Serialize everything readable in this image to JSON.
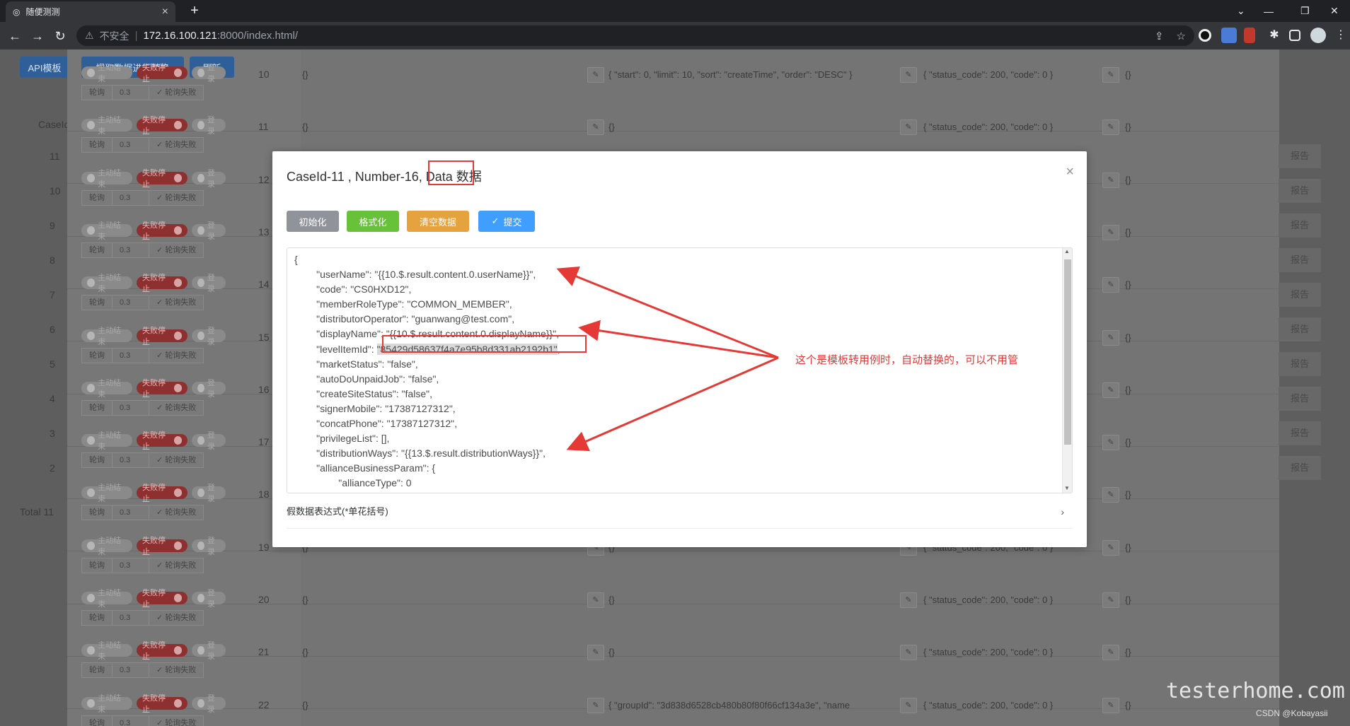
{
  "browser": {
    "tab_title": "随便测测",
    "insecure_label": "不安全",
    "url_host": "172.16.100.121",
    "url_path": ":8000/index.html/"
  },
  "toolbar": {
    "api_label": "API模板",
    "extract_label": "提取数据进行替换",
    "refresh_label": "刷新"
  },
  "left": {
    "caseid_header": "CaseId",
    "ids": [
      "11",
      "10",
      "9",
      "8",
      "7",
      "6",
      "5",
      "4",
      "3",
      "2"
    ],
    "total_label": "Total 11"
  },
  "row_controls": {
    "active_label": "主动结束",
    "fail_stop_label": "失败停止",
    "login_label": "登录",
    "poll_label": "轮询",
    "poll_value": "0.3",
    "poll_fail_label": "轮询失败"
  },
  "rows": [
    {
      "num": "10",
      "data": "{}",
      "params": "{ \"start\": 0, \"limit\": 10, \"sort\": \"createTime\", \"order\": \"DESC\" }",
      "expect": "{ \"status_code\": 200, \"code\": 0 }",
      "extra": "{}"
    },
    {
      "num": "11",
      "data": "{}",
      "params": "{}",
      "expect": "{ \"status_code\": 200, \"code\": 0 }",
      "extra": "{}"
    },
    {
      "num": "12",
      "data": "",
      "params": "",
      "expect": "",
      "extra": "{}"
    },
    {
      "num": "13",
      "data": "",
      "params": "",
      "expect": "",
      "extra": "{}"
    },
    {
      "num": "14",
      "data": "",
      "params": "",
      "expect": "",
      "extra": "{}"
    },
    {
      "num": "15",
      "data": "",
      "params": "",
      "expect": "",
      "extra": "{}"
    },
    {
      "num": "16",
      "data": "",
      "params": "",
      "expect": "",
      "extra": "{}"
    },
    {
      "num": "17",
      "data": "",
      "params": "",
      "expect": "",
      "extra": "{}"
    },
    {
      "num": "18",
      "data": "",
      "params": "",
      "expect": "",
      "extra": "{}"
    },
    {
      "num": "19",
      "data": "{}",
      "params": "{}",
      "expect": "{ \"status_code\": 200, \"code\": 0 }",
      "extra": "{}"
    },
    {
      "num": "20",
      "data": "{}",
      "params": "{}",
      "expect": "{ \"status_code\": 200, \"code\": 0 }",
      "extra": "{}"
    },
    {
      "num": "21",
      "data": "{}",
      "params": "{}",
      "expect": "{ \"status_code\": 200, \"code\": 0 }",
      "extra": "{}"
    },
    {
      "num": "22",
      "data": "{}",
      "params": "{ \"groupId\": \"3d838d6528cb480b80f80f66cf134a3e\", \"name",
      "expect": "{ \"status_code\": 200, \"code\": 0 }",
      "extra": "{}"
    }
  ],
  "report_label": "报告",
  "modal": {
    "title_prefix": "CaseId-11 , Number-16",
    "title_data": ", Data",
    "title_suffix": " 数据",
    "btn_init": "初始化",
    "btn_format": "格式化",
    "btn_clear": "清空数据",
    "btn_submit": "提交",
    "json_lines": [
      "{",
      "        \"userName\": \"{{10.$.result.content.0.userName}}\",",
      "        \"code\": \"CS0HXD12\",",
      "        \"memberRoleType\": \"COMMON_MEMBER\",",
      "        \"distributorOperator\": \"guanwang@test.com\",",
      "        \"displayName\": \"{{10.$.result.content.0.displayName}}\",",
      "        \"levelItemId\": ",
      "        \"marketStatus\": \"false\",",
      "        \"autoDoUnpaidJob\": \"false\",",
      "        \"createSiteStatus\": \"false\",",
      "        \"signerMobile\": \"17387127312\",",
      "        \"concatPhone\": \"17387127312\",",
      "        \"privilegeList\": [],",
      "        \"distributionWays\": \"{{13.$.result.distributionWays}}\",",
      "        \"allianceBusinessParam\": {",
      "                \"allianceType\": 0"
    ],
    "level_value": "\"85429d58637f4a7e95b8d331ab2192b1\"",
    "level_tail": ",",
    "collapse_label": "假数据表达式(*单花括号)",
    "annotation": "这个是模板转用例时，自动替换的，可以不用管"
  },
  "watermark": {
    "brand": "testerhome.com",
    "author": "CSDN @Kobayasii"
  }
}
